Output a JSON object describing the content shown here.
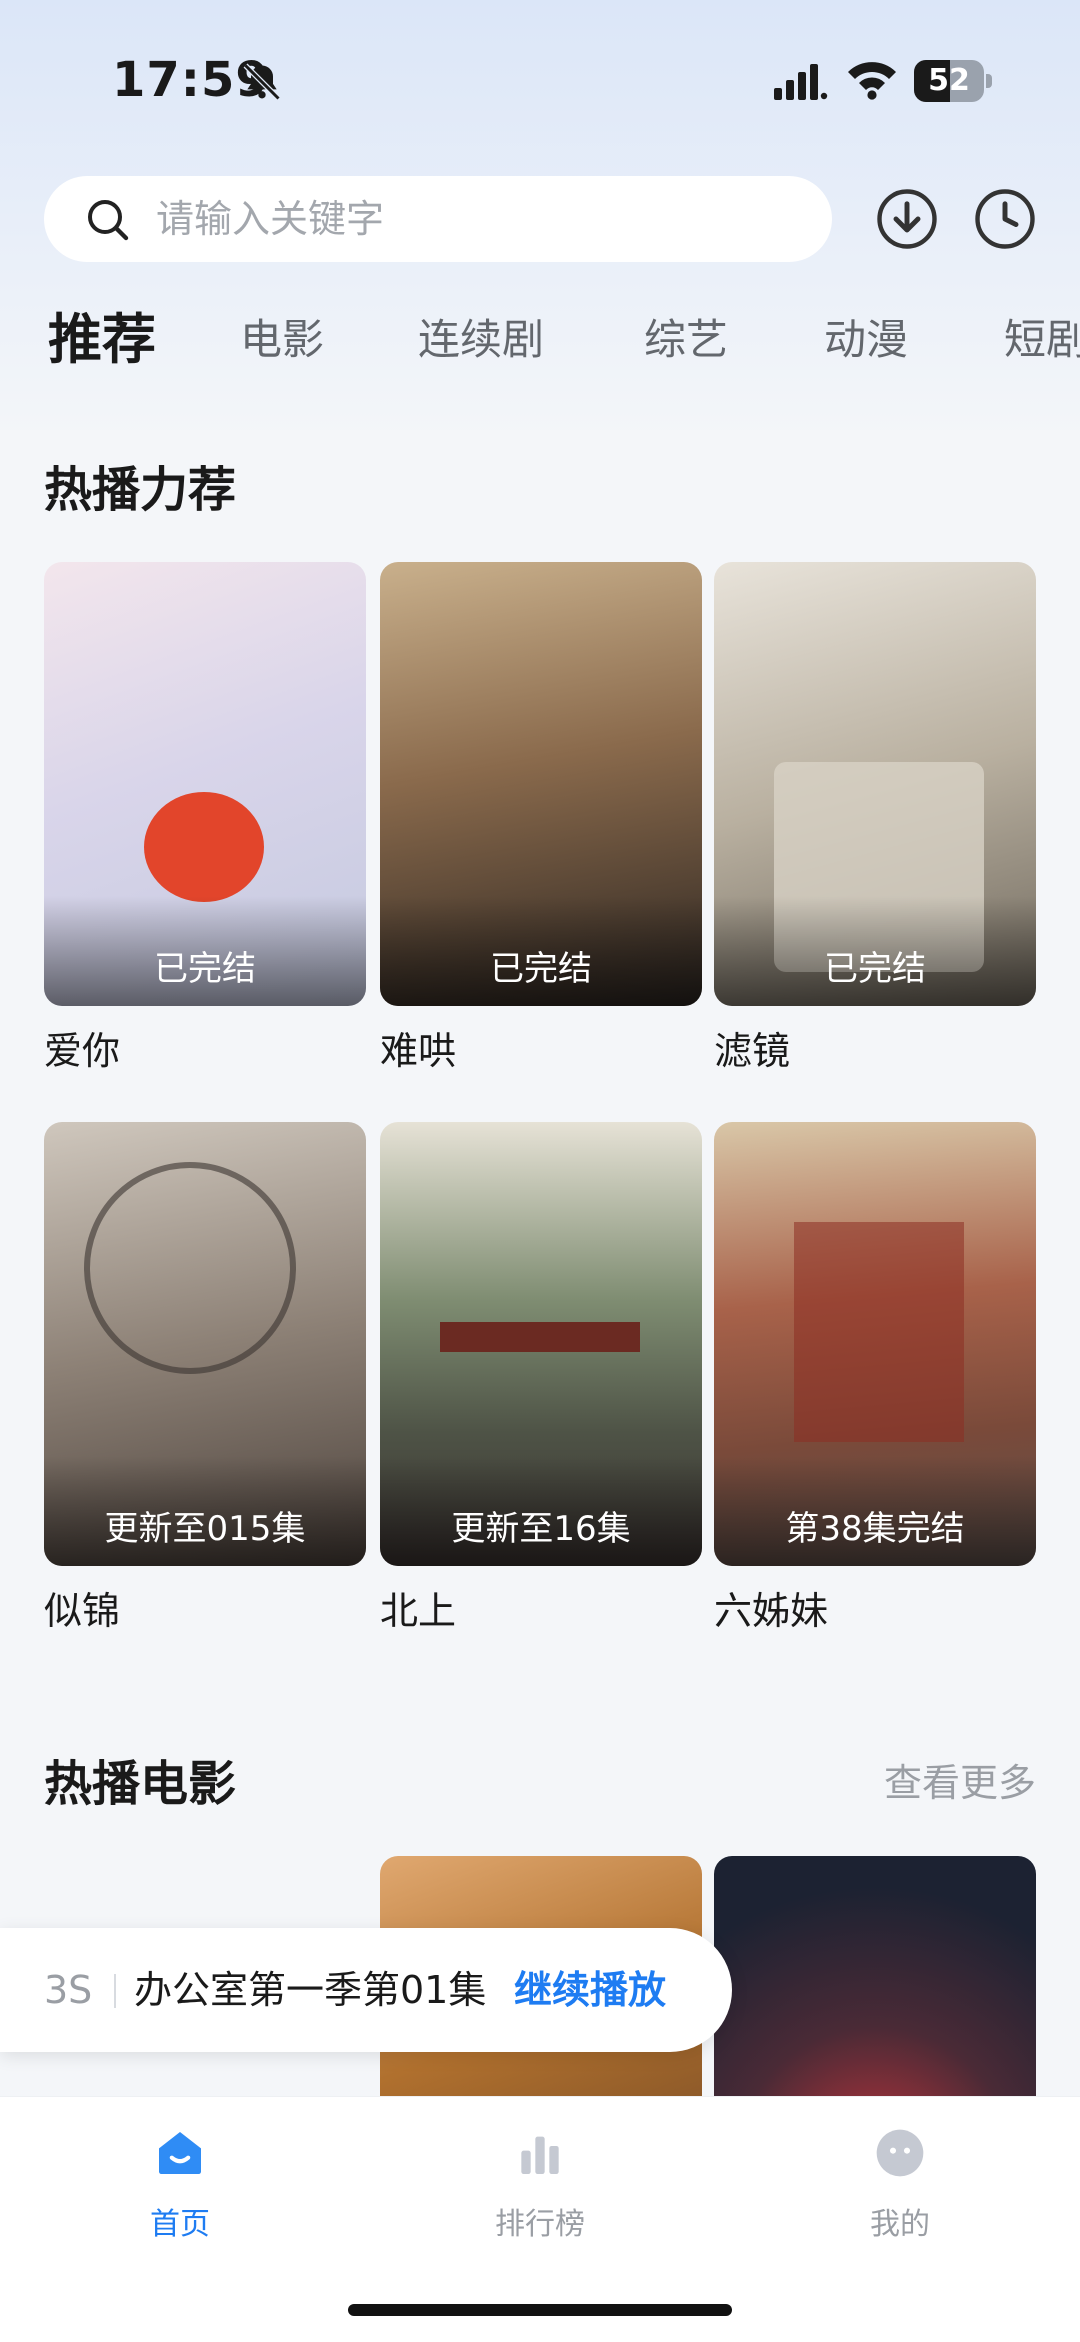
{
  "status_bar": {
    "time": "17:59",
    "battery": "52",
    "battery_level": 0.52
  },
  "search": {
    "placeholder": "请输入关键字"
  },
  "header_icons": [
    "download-icon",
    "history-icon"
  ],
  "tabs": [
    "推荐",
    "电影",
    "连续剧",
    "综艺",
    "动漫",
    "短剧"
  ],
  "hot_section": {
    "title": "热播力荐",
    "items": [
      {
        "title": "爱你",
        "badge": "已完结"
      },
      {
        "title": "难哄",
        "badge": "已完结"
      },
      {
        "title": "滤镜",
        "badge": "已完结"
      },
      {
        "title": "似锦",
        "badge": "更新至015集"
      },
      {
        "title": "北上",
        "badge": "更新至16集"
      },
      {
        "title": "六姊妹",
        "badge": "第38集完结"
      }
    ]
  },
  "movie_section": {
    "title": "热播电影",
    "more": "查看更多"
  },
  "resume_bar": {
    "countdown": "3S",
    "episode": "办公室第一季第01集",
    "action": "继续播放"
  },
  "bottom_nav": [
    {
      "label": "首页",
      "icon": "home-icon",
      "active": true
    },
    {
      "label": "排行榜",
      "icon": "ranking-icon",
      "active": false
    },
    {
      "label": "我的",
      "icon": "profile-icon",
      "active": false
    }
  ],
  "colors": {
    "accent": "#1e7cf2",
    "background": "#f4f6f9"
  }
}
